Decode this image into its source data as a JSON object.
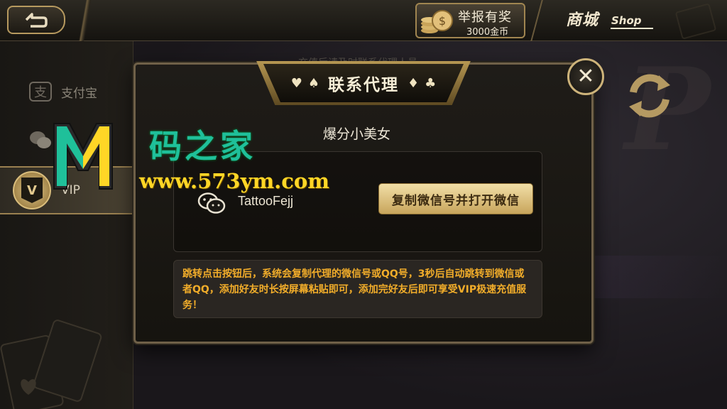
{
  "topbar": {
    "back_icon": "return-arrow-icon",
    "report": {
      "title": "举报有奖",
      "reward": "3000金币",
      "icon": "coin-stack-icon"
    },
    "shop": {
      "label": "商城",
      "label_en": "Shop"
    }
  },
  "sidebar": {
    "items": [
      {
        "label": "支付宝",
        "icon": "alipay-icon"
      },
      {
        "label": "",
        "icon": "wechat-icon"
      },
      {
        "label": "VIP",
        "icon": "vip-badge-icon",
        "badge": "V",
        "active": true
      }
    ]
  },
  "background": {
    "marquee": "充值后请及时联系代理人员"
  },
  "modal": {
    "title": "联系代理",
    "agent_name": "爆分小美女",
    "wechat_id": "TattooFejj",
    "copy_button": "复制微信号并打开微信",
    "notice": "跳转点击按钮后，系统会复制代理的微信号或QQ号，3秒后自动跳转到微信或者QQ，添加好友时长按屏幕粘贴即可，添加完好友后即可享受VIP极速充值服务！",
    "close_icon": "close-icon",
    "suits": [
      "♥",
      "♠",
      "♦",
      "♣"
    ]
  },
  "watermark": {
    "title": "码之家",
    "url": "www.573ym.com"
  },
  "colors": {
    "gold": "#c8a55c",
    "notice_text": "#f2ad2a",
    "watermark_green": "#1fc09a",
    "watermark_yellow": "#ffd626"
  }
}
